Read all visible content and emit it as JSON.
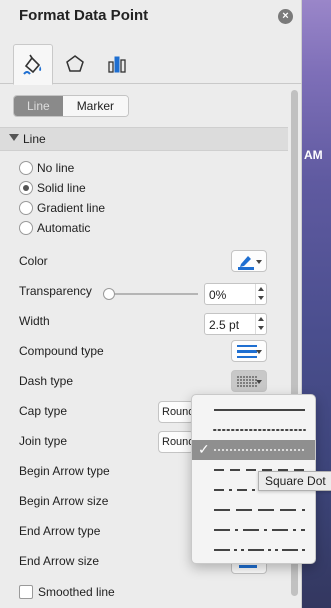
{
  "pane": {
    "title": "Format Data Point",
    "close_icon": "close-icon"
  },
  "icon_tabs": [
    {
      "name": "fill-line-icon",
      "active": true
    },
    {
      "name": "effects-pentagon-icon",
      "active": false
    },
    {
      "name": "series-options-icon",
      "active": false
    }
  ],
  "segment": {
    "line_label": "Line",
    "marker_label": "Marker",
    "selected": "Line"
  },
  "section": {
    "label": "Line"
  },
  "line_options": [
    {
      "label": "No line",
      "selected": false
    },
    {
      "label": "Solid line",
      "selected": true
    },
    {
      "label": "Gradient line",
      "selected": false
    },
    {
      "label": "Automatic",
      "selected": false
    }
  ],
  "properties": {
    "color_label": "Color",
    "transparency_label": "Transparency",
    "transparency_value": "0%",
    "width_label": "Width",
    "width_value": "2.5 pt",
    "compound_label": "Compound type",
    "dash_label": "Dash type",
    "cap_label": "Cap type",
    "cap_value": "Round",
    "join_label": "Join type",
    "join_value": "Round",
    "begin_arrow_type_label": "Begin Arrow type",
    "begin_arrow_size_label": "Begin Arrow size",
    "end_arrow_type_label": "End Arrow type",
    "end_arrow_size_label": "End Arrow size",
    "smoothed_label": "Smoothed line",
    "smoothed_checked": false
  },
  "colors": {
    "pen_color": "#1f6fd1",
    "selected_row": "#8f8f8f"
  },
  "dash_menu": {
    "options": [
      "solid",
      "round-dot",
      "square-dot",
      "dash",
      "dash-dot",
      "long-dash",
      "long-dash-dot",
      "long-dash-dot-dot"
    ],
    "selected_index": 2
  },
  "tooltip": {
    "text": "Square Dot"
  },
  "desktop": {
    "clock_fragment": "AM"
  }
}
